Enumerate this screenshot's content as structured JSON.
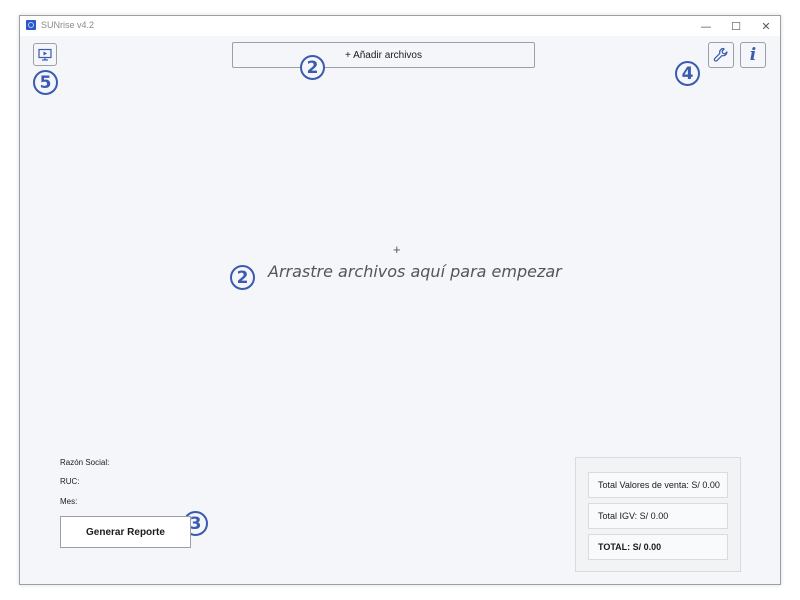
{
  "window": {
    "title": "SUNrise v4.2",
    "controls": {
      "minimize": "—",
      "maximize": "☐",
      "close": "✕"
    }
  },
  "toolbar": {
    "add_files_label": "+ Añadir archivos",
    "settings_icon": "wrench-icon",
    "info_icon": "info-icon",
    "presentation_icon": "presentation-icon",
    "info_glyph": "i"
  },
  "dropzone": {
    "plus": "+",
    "text": "Arrastre archivos aquí para empezar"
  },
  "company_info": {
    "razon_social_label": "Razón Social:",
    "ruc_label": "RUC:",
    "mes_label": "Mes:"
  },
  "actions": {
    "generate_report_label": "Generar Reporte"
  },
  "totals": {
    "valores_venta": "Total Valores de venta: S/ 0.00",
    "igv": "Total IGV: S/ 0.00",
    "total": "TOTAL: S/ 0.00"
  },
  "annotations": {
    "badge_top": "2",
    "badge_center": "2",
    "badge_generate": "3",
    "badge_settings": "4",
    "badge_display": "5"
  },
  "colors": {
    "accent": "#3a5bb0",
    "background": "#f4f6f9",
    "border": "#9aa0a6"
  }
}
